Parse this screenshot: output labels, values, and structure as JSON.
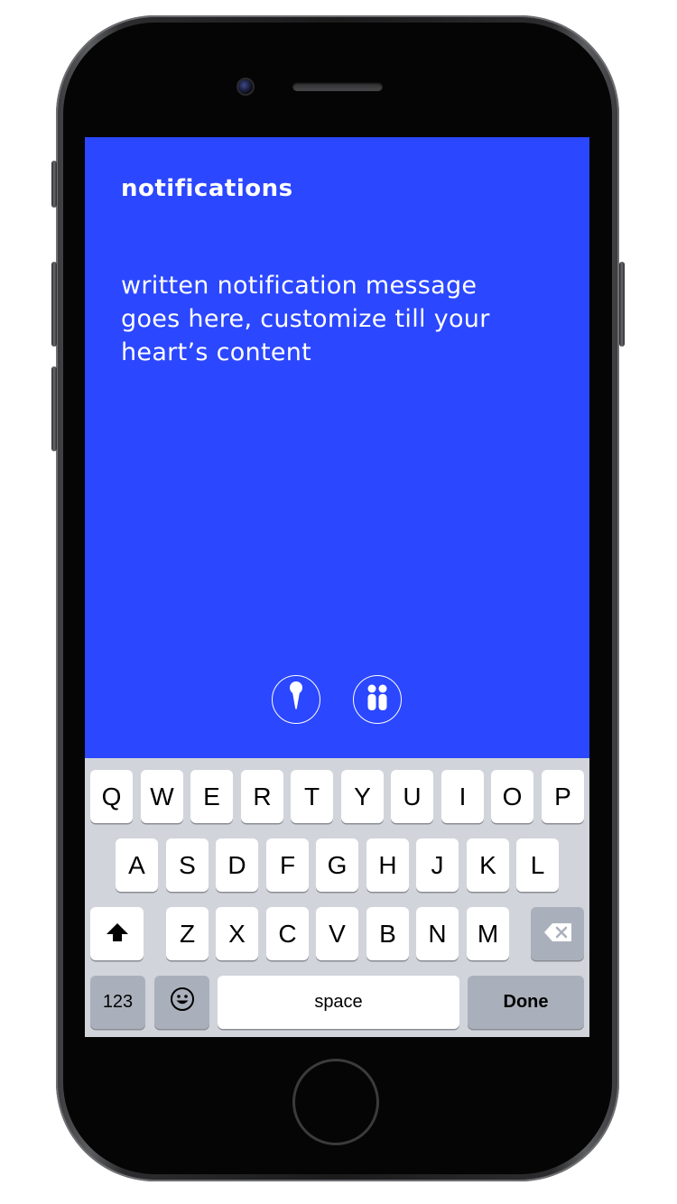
{
  "app": {
    "title": "notifications",
    "message": "written notification message goes here, customize till your heart’s content",
    "background_color": "#2b47ff"
  },
  "actions": [
    {
      "name": "pin",
      "icon": "pin-icon"
    },
    {
      "name": "pause",
      "icon": "pause-icon"
    }
  ],
  "keyboard": {
    "row1": [
      "Q",
      "W",
      "E",
      "R",
      "T",
      "Y",
      "U",
      "I",
      "O",
      "P"
    ],
    "row2": [
      "A",
      "S",
      "D",
      "F",
      "G",
      "H",
      "J",
      "K",
      "L"
    ],
    "row3": [
      "Z",
      "X",
      "C",
      "V",
      "B",
      "N",
      "M"
    ],
    "shift_icon": "shift-icon",
    "backspace_icon": "backspace-icon",
    "numbers_label": "123",
    "emoji_icon": "emoji-icon",
    "space_label": "space",
    "done_label": "Done"
  }
}
